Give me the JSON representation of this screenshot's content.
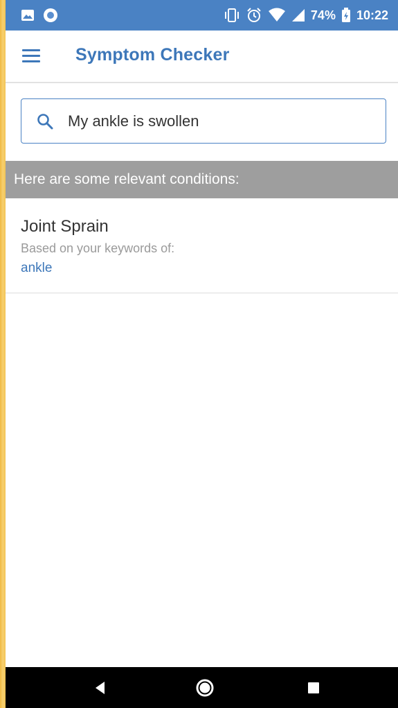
{
  "status_bar": {
    "battery": "74%",
    "time": "10:22",
    "left_icons": [
      "gallery-icon",
      "circle-notification-icon"
    ],
    "right_icons": [
      "vibrate-icon",
      "alarm-icon",
      "wifi-icon",
      "signal-icon",
      "battery-charging-icon"
    ],
    "color": "#4a82c4"
  },
  "app_bar": {
    "title": "Symptom Checker",
    "menu_icon": "hamburger-menu-icon",
    "accent_color": "#3d77b9"
  },
  "search": {
    "value": "My ankle is swollen",
    "icon": "search-icon"
  },
  "results": {
    "header": "Here are some relevant conditions:",
    "items": [
      {
        "title": "Joint Sprain",
        "subtitle": "Based on your keywords of:",
        "keyword": "ankle"
      }
    ]
  },
  "nav_bar": {
    "buttons": [
      "back-icon",
      "home-icon",
      "recents-icon"
    ]
  }
}
